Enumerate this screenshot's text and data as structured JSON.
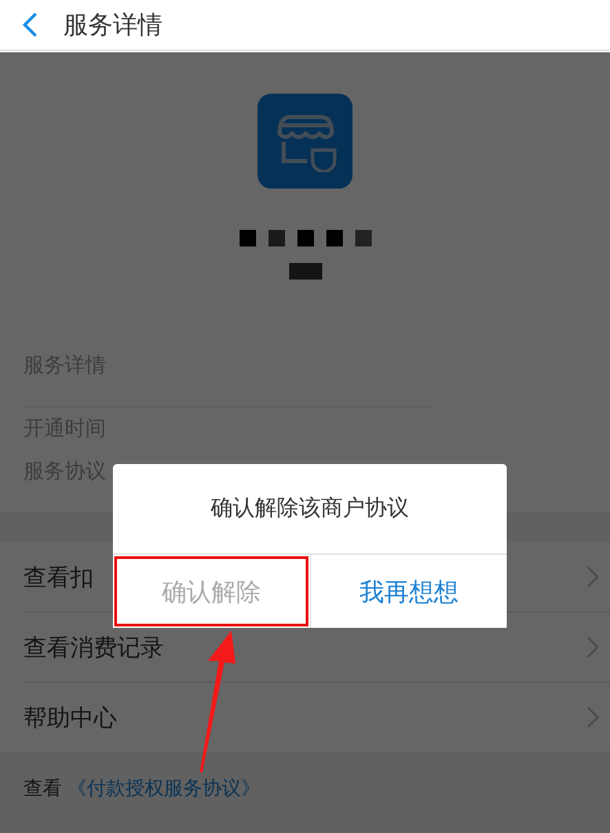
{
  "header": {
    "title": "服务详情"
  },
  "details": [
    {
      "label": "服务详情"
    },
    {
      "label": "开通时间"
    },
    {
      "label": "服务协议"
    }
  ],
  "menu": [
    {
      "label": "查看扣"
    },
    {
      "label": "查看消费记录"
    },
    {
      "label": "帮助中心"
    }
  ],
  "footer": {
    "prefix": "查看",
    "link": "《付款授权服务协议》"
  },
  "dialog": {
    "message": "确认解除该商户协议",
    "buttons": [
      {
        "label": "确认解除",
        "kind": "confirm",
        "highlighted": true
      },
      {
        "label": "我再想想",
        "kind": "cancel",
        "highlighted": false
      }
    ]
  }
}
